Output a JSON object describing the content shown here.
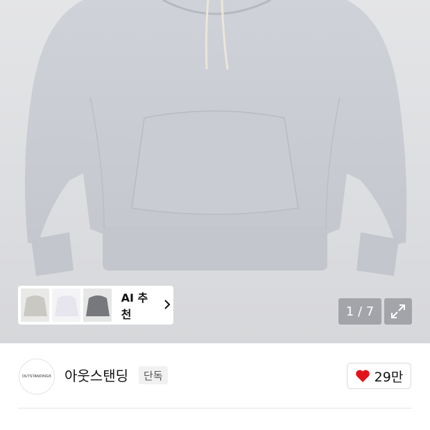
{
  "recommendation": {
    "label": "AI 추천",
    "thumbnails": [
      "gray-hoodie-thumb",
      "white-hoodie-thumb",
      "charcoal-hoodie-thumb"
    ]
  },
  "gallery": {
    "counter": "1 / 7"
  },
  "brand": {
    "logo_text": "OUTSTANDING®",
    "name": "아웃스탠딩",
    "badge": "단독"
  },
  "like": {
    "count": "29만",
    "color": "#e3131b"
  }
}
